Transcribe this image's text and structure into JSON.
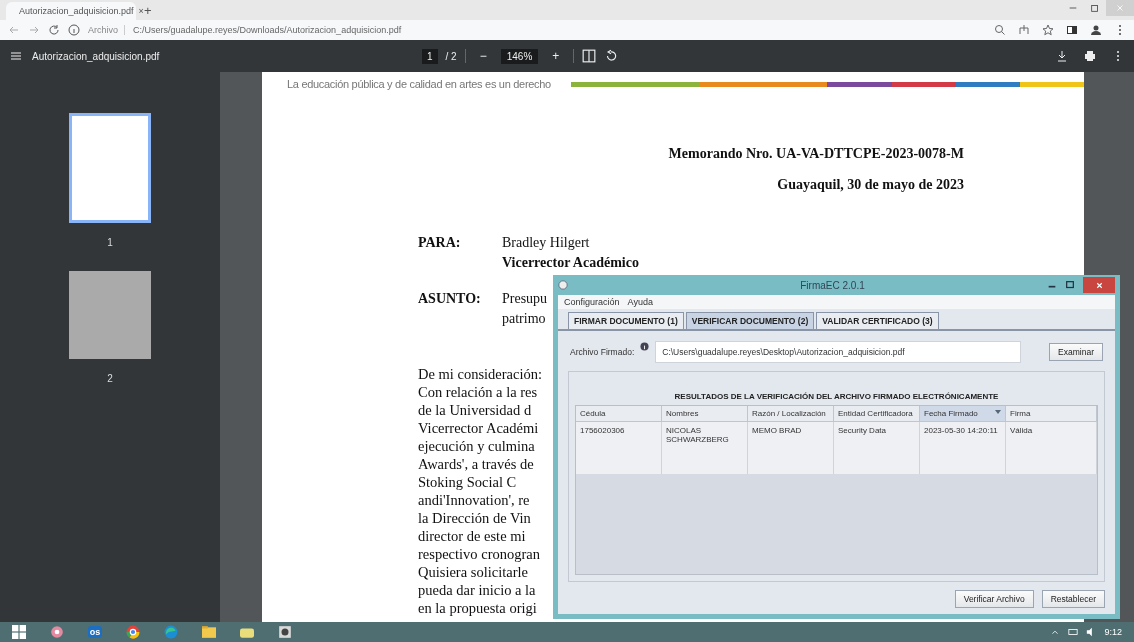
{
  "browser": {
    "tab": {
      "title": "Autorizacion_adquisicion.pdf",
      "close": "×",
      "selected": true
    },
    "new_tab": "+",
    "address": {
      "scheme": "Archivo",
      "url": "C:/Users/guadalupe.reyes/Downloads/Autorizacion_adquisicion.pdf"
    }
  },
  "pdf_toolbar": {
    "title": "Autorizacion_adquisicion.pdf",
    "page": "1",
    "page_count": "/ 2",
    "zoom_out": "−",
    "zoom": "146%",
    "zoom_in": "+"
  },
  "thumbnails": [
    {
      "label": "1",
      "selected": true
    },
    {
      "label": "2",
      "selected": false
    }
  ],
  "document": {
    "motto": "La educación pública y de calidad en artes es un derecho",
    "memo_number": "Memorando Nro. UA-VA-DTTCPE-2023-0078-M",
    "place_date": "Guayaquil, 30 de mayo de 2023",
    "fields": [
      {
        "label": "PARA:",
        "lines": [
          "Bradley Hilgert",
          "**Vicerrector Académico**"
        ]
      },
      {
        "label": "ASUNTO:",
        "lines": [
          "Presupu",
          "patrimo"
        ]
      }
    ],
    "body": [
      "De mi consideración:",
      "Con relación a la res",
      "de la Universidad d",
      "Vicerrector Académi",
      "ejecución y culmina",
      "Awards', a través de",
      "Stoking Social C",
      "andi'Innovation', re",
      "la Dirección de Vin",
      "director de este mi",
      "respectivo cronogran",
      "Quisiera solicitarle",
      "pueda dar inicio a la",
      "en la propuesta origi"
    ]
  },
  "dialog": {
    "title": "FirmaEC 2.0.1",
    "menu": [
      "Configuración",
      "Ayuda"
    ],
    "tabs": [
      {
        "label": "FIRMAR DOCUMENTO (1)",
        "selected": false
      },
      {
        "label": "VERIFICAR DOCUMENTO (2)",
        "selected": true
      },
      {
        "label": "VALIDAR CERTIFICADO (3)",
        "selected": false
      }
    ],
    "file_label": "Archivo Firmado:",
    "file_value": "C:\\Users\\guadalupe.reyes\\Desktop\\Autorizacion_adquisicion.pdf",
    "browse": "Examinar",
    "results_title": "RESULTADOS DE LA VERIFICACIÓN DEL ARCHIVO FIRMADO ELECTRÓNICAMENTE",
    "table": {
      "columns": [
        {
          "label": "Cédula",
          "sorted": false
        },
        {
          "label": "Nombres",
          "sorted": false
        },
        {
          "label": "Razón / Localización",
          "sorted": false
        },
        {
          "label": "Entidad Certificadora",
          "sorted": false
        },
        {
          "label": "Fecha Firmado",
          "sorted": true
        },
        {
          "label": "Firma",
          "sorted": false
        }
      ],
      "rows": [
        [
          "1756020306",
          "NICOLAS SCHWARZBERG",
          "MEMO BRAD",
          "Security Data",
          "2023-05-30 14:20:11",
          "Válida"
        ]
      ]
    },
    "buttons": [
      "Verificar Archivo",
      "Restablecer"
    ]
  },
  "taskbar": {
    "apps": [
      {
        "kind": "windows"
      },
      {
        "kind": "pink"
      },
      {
        "kind": "outlook",
        "label": "os"
      },
      {
        "kind": "chrome"
      },
      {
        "kind": "edge"
      },
      {
        "kind": "folder"
      },
      {
        "kind": "folder2"
      },
      {
        "kind": "app"
      }
    ],
    "time": "9:12"
  }
}
